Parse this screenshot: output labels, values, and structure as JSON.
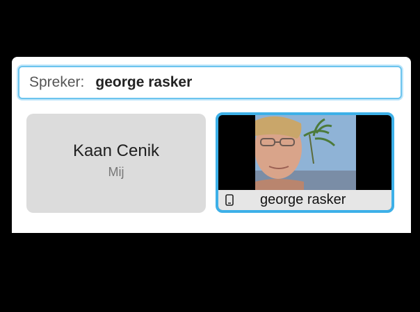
{
  "speaker_bar": {
    "label": "Spreker:",
    "name": "george rasker"
  },
  "participants": [
    {
      "name": "Kaan Cenik",
      "subtitle": "Mij"
    },
    {
      "name": "george rasker",
      "device_icon": "phone-icon"
    }
  ],
  "colors": {
    "accent": "#3db0e8",
    "tile_bg": "#dcdcdc",
    "background": "#000000"
  }
}
